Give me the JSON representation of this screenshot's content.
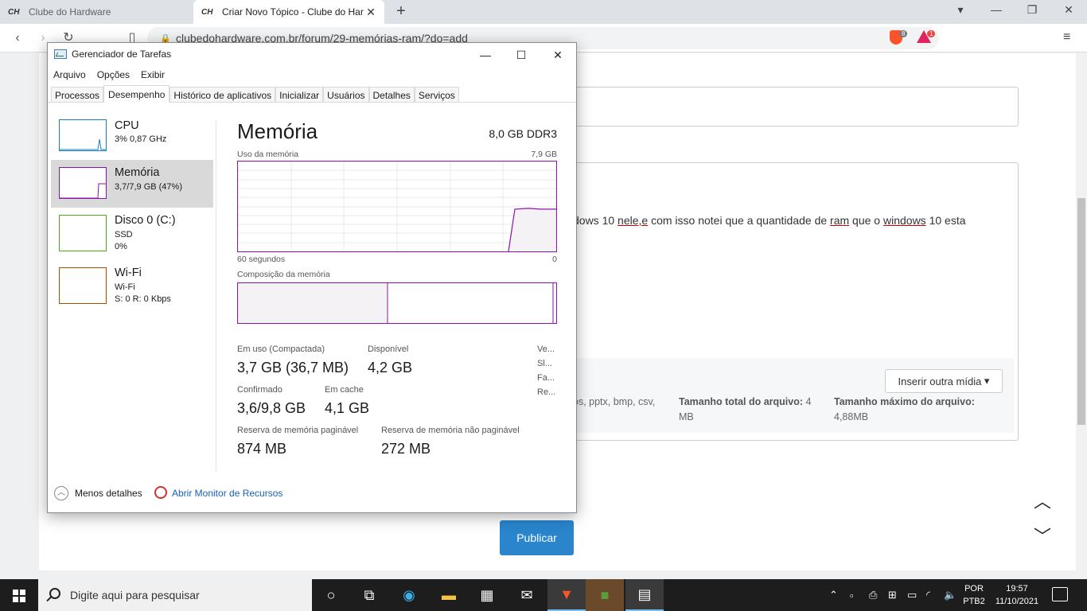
{
  "browser": {
    "tabs": [
      {
        "favicon": "CH",
        "title": "Clube do Hardware"
      },
      {
        "favicon": "CH",
        "title": "Criar Novo Tópico - Clube do Har"
      }
    ],
    "url": "clubedohardware.com.br/forum/29-memórias-ram/?do=add",
    "shield_count": "8",
    "rewards_count": "1"
  },
  "webpage": {
    "editor_text_parts": [
      "dows 10 ",
      "nele,e",
      " com isso notei que a quantidade de ",
      "ram",
      " que o ",
      "windows",
      " 10 esta"
    ],
    "insert_media": "Inserir outra mídia",
    "file_types": "os, pptx, bmp, csv,",
    "total_size_label": "Tamanho total do arquivo:",
    "total_size_value_1": "4",
    "total_size_value_2": "MB",
    "max_size_label": "Tamanho máximo do arquivo:",
    "max_size_value": "4,88MB",
    "publish": "Publicar"
  },
  "taskmgr": {
    "title": "Gerenciador de Tarefas",
    "menu": [
      "Arquivo",
      "Opções",
      "Exibir"
    ],
    "tabs": [
      "Processos",
      "Desempenho",
      "Histórico de aplicativos",
      "Inicializar",
      "Usuários",
      "Detalhes",
      "Serviços"
    ],
    "active_tab": "Desempenho",
    "side": [
      {
        "name": "CPU",
        "line1": "3% 0,87 GHz",
        "line2": "",
        "color": "#1a7fc3"
      },
      {
        "name": "Memória",
        "line1": "3,7/7,9 GB (47%)",
        "line2": "",
        "color": "#8b12ae"
      },
      {
        "name": "Disco 0 (C:)",
        "line1": "SSD",
        "line2": "0%",
        "color": "#4daa1c"
      },
      {
        "name": "Wi-Fi",
        "line1": "Wi-Fi",
        "line2": "S: 0 R: 0 Kbps",
        "color": "#a74f01"
      }
    ],
    "heading": "Memória",
    "mem_type": "8,0 GB DDR3",
    "usage_label": "Uso da memória",
    "usage_max": "7,9 GB",
    "time_label": "60 segundos",
    "time_end": "0",
    "composition_label": "Composição da memória",
    "composition_inuse_fraction": 0.47,
    "usage_history_fraction": 0.47,
    "stats": {
      "in_use_label": "Em uso (Compactada)",
      "in_use_value": "3,7 GB (36,7 MB)",
      "available_label": "Disponível",
      "available_value": "4,2 GB",
      "committed_label": "Confirmado",
      "committed_value": "3,6/9,8 GB",
      "cached_label": "Em cache",
      "cached_value": "4,1 GB",
      "paged_label": "Reserva de memória paginável",
      "paged_value": "874 MB",
      "nonpaged_label": "Reserva de memória não paginável",
      "nonpaged_value": "272 MB"
    },
    "right_col": [
      "Ve...",
      "Sl...",
      "Fa...",
      "Re..."
    ],
    "fewer_details": "Menos detalhes",
    "resource_monitor": "Abrir Monitor de Recursos"
  },
  "taskbar": {
    "search_placeholder": "Digite aqui para pesquisar",
    "lang_1": "POR",
    "lang_2": "PTB2",
    "time": "19:57",
    "date": "11/10/2021"
  }
}
